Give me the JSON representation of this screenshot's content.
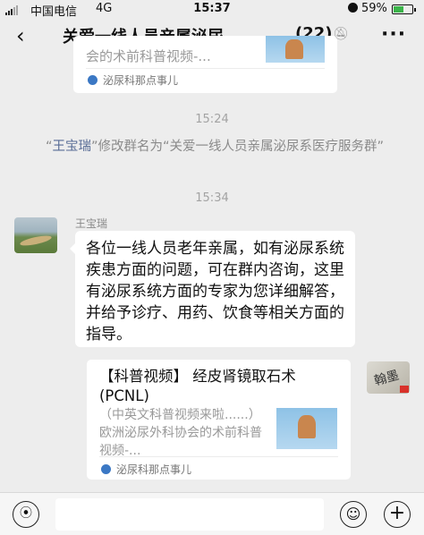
{
  "status_bar": {
    "carrier": "中国电信",
    "network": "4G",
    "time": "15:37",
    "battery": "59%",
    "battery_level": 0.59
  },
  "nav": {
    "back_icon": "chevron-left",
    "title": "关爱一线人员亲属泌尿...",
    "member_count": "(22)",
    "more_icon": "ellipsis"
  },
  "messages": {
    "top_card": {
      "description_tail": "会的术前科普视频-...",
      "source": "泌尿科那点事儿"
    },
    "timestamp_1": "15:24",
    "system": {
      "quote_open": "“",
      "name": "王宝瑞",
      "text": "”修改群名为“关爱一线人员亲属泌尿系医疗服务群”"
    },
    "timestamp_2": "15:34",
    "text_message": {
      "sender": "王宝瑞",
      "text": "各位一线人员老年亲属，如有泌尿系统疾患方面的问题，可在群内咨询，这里有泌尿系统方面的专家为您详细解答，并给予诊疗、用药、饮食等相关方面的指导。"
    },
    "link_card": {
      "title": "【科普视频】 经皮肾镜取石术 (PCNL)",
      "description": "（中英文科普视频来啦......）欧洲泌尿外科协会的术前科普视频-...",
      "source": "泌尿科那点事儿"
    }
  },
  "input_bar": {
    "placeholder": "",
    "voice_icon": "voice-wave",
    "emoji_icon": "smiley",
    "plus_icon": "plus"
  },
  "colors": {
    "background": "#ededed",
    "bubble": "#ffffff",
    "name_link": "#576b95",
    "battery": "#3bb44a"
  }
}
